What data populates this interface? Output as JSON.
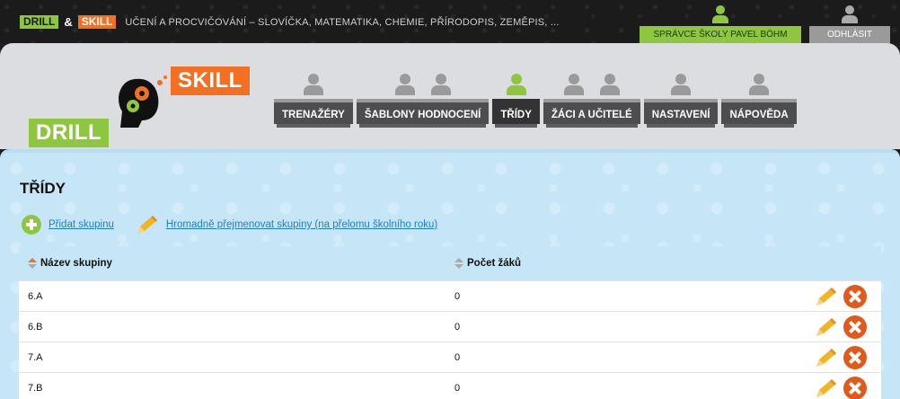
{
  "topbar": {
    "brand_drill": "DRILL",
    "brand_amp": "&",
    "brand_skill": "SKILL",
    "tagline": "UČENÍ A PROCVIČOVÁNÍ – SLOVÍČKA, MATEMATIKA, CHEMIE, PŘÍRODOPIS, ZEMĚPIS, ...",
    "admin_label": "SPRÁVCE ŠKOLY PAVEL BÖHM",
    "logout_label": "ODHLÁSIT"
  },
  "logo": {
    "drill": "DRILL",
    "skill": "SKILL"
  },
  "nav": {
    "items": [
      {
        "label": "TRENAŽÉRY"
      },
      {
        "label": "ŠABLONY HODNOCENÍ"
      },
      {
        "label": "TŘÍDY"
      },
      {
        "label": "ŽÁCI A UČITELÉ"
      },
      {
        "label": "NASTAVENÍ"
      },
      {
        "label": "NÁPOVĚDA"
      }
    ]
  },
  "main": {
    "title": "TŘÍDY",
    "add_group": "Přidat skupinu",
    "bulk_rename": "Hromadně přejmenovat skupiny (na přelomu školního roku)",
    "table": {
      "columns": [
        "Název skupiny",
        "Počet žáků"
      ],
      "rows": [
        {
          "name": "6.A",
          "count": "0"
        },
        {
          "name": "6.B",
          "count": "0"
        },
        {
          "name": "7.A",
          "count": "0"
        },
        {
          "name": "7.B",
          "count": "0"
        }
      ]
    }
  },
  "colors": {
    "green": "#8ec63f",
    "orange": "#f36f21",
    "link": "#1f7fc0",
    "content_bg": "#c6e6f7"
  }
}
